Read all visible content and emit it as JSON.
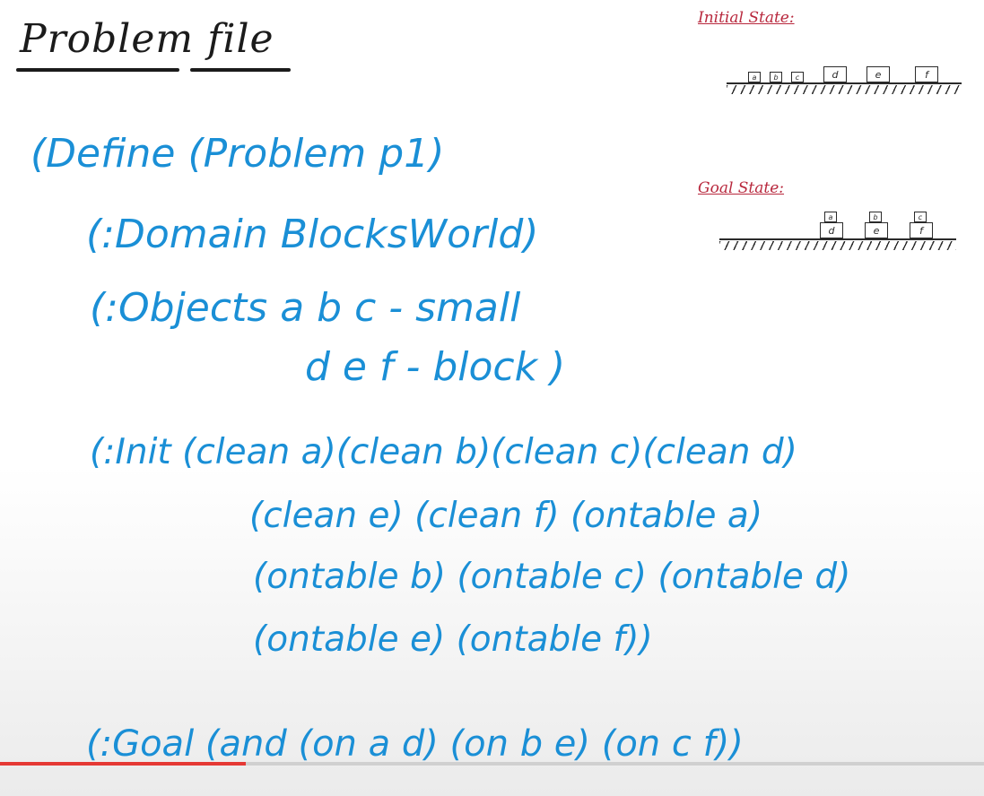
{
  "title": "Problem file",
  "code_lines": [
    "(Define (Problem p1)",
    "(:Domain BlocksWorld)",
    "(:Objects a b c - small",
    "d e f - block )",
    "(:Init (clean a)(clean b)(clean c)(clean d)",
    "(clean e) (clean f) (ontable a)",
    "(ontable b) (ontable c) (ontable d)",
    "(ontable e) (ontable f))",
    "(:Goal (and (on a d) (on b e) (on c f))"
  ],
  "initial_state": {
    "label": "Initial State:",
    "small_blocks": [
      "a",
      "b",
      "c"
    ],
    "big_blocks": [
      "d",
      "e",
      "f"
    ]
  },
  "goal_state": {
    "label": "Goal State:",
    "stacks": [
      {
        "top": "a",
        "bottom": "d"
      },
      {
        "top": "b",
        "bottom": "e"
      },
      {
        "top": "c",
        "bottom": "f"
      }
    ]
  },
  "video_progress": 0.25,
  "colors": {
    "ink_blue": "#1a8fd6",
    "ink_black": "#1b1b1b",
    "ink_red": "#b8283d",
    "progress_red": "#e53935"
  }
}
